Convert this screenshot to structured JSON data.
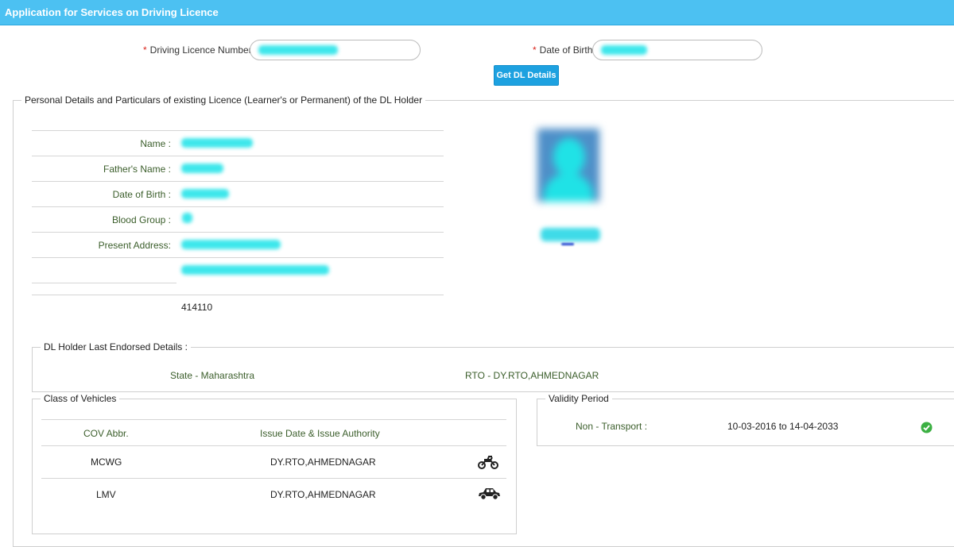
{
  "header": {
    "title": "Application for Services on Driving Licence"
  },
  "search": {
    "dl_number_label": "Driving Licence Number",
    "dob_label": "Date of Birth",
    "get_button": "Get DL Details"
  },
  "personal": {
    "legend": "Personal Details and Particulars of existing Licence (Learner's or Permanent) of the DL Holder",
    "name_label": "Name :",
    "father_label": "Father's Name :",
    "dob_label": "Date of Birth :",
    "blood_label": "Blood Group :",
    "address_label": "Present Address:",
    "pincode": "414110"
  },
  "endorsed": {
    "legend": "DL Holder Last Endorsed Details :",
    "state": "State - Maharashtra",
    "rto": "RTO - DY.RTO,AHMEDNAGAR"
  },
  "vehicles": {
    "legend": "Class of Vehicles",
    "col_abbr": "COV Abbr.",
    "col_issue": "Issue Date & Issue Authority",
    "rows": [
      {
        "abbr": "MCWG",
        "authority": "DY.RTO,AHMEDNAGAR",
        "icon": "motorcycle-icon"
      },
      {
        "abbr": "LMV",
        "authority": "DY.RTO,AHMEDNAGAR",
        "icon": "car-icon"
      }
    ]
  },
  "validity": {
    "legend": "Validity Period",
    "type": "Non - Transport :",
    "period": "10-03-2016 to 14-04-2033",
    "status_icon": "check-circle-icon"
  },
  "colors": {
    "header": "#4cc1f2",
    "button": "#1da1e0",
    "label_green": "#3b5e2b",
    "redaction": "#1de3e8",
    "valid": "#3cb043"
  }
}
